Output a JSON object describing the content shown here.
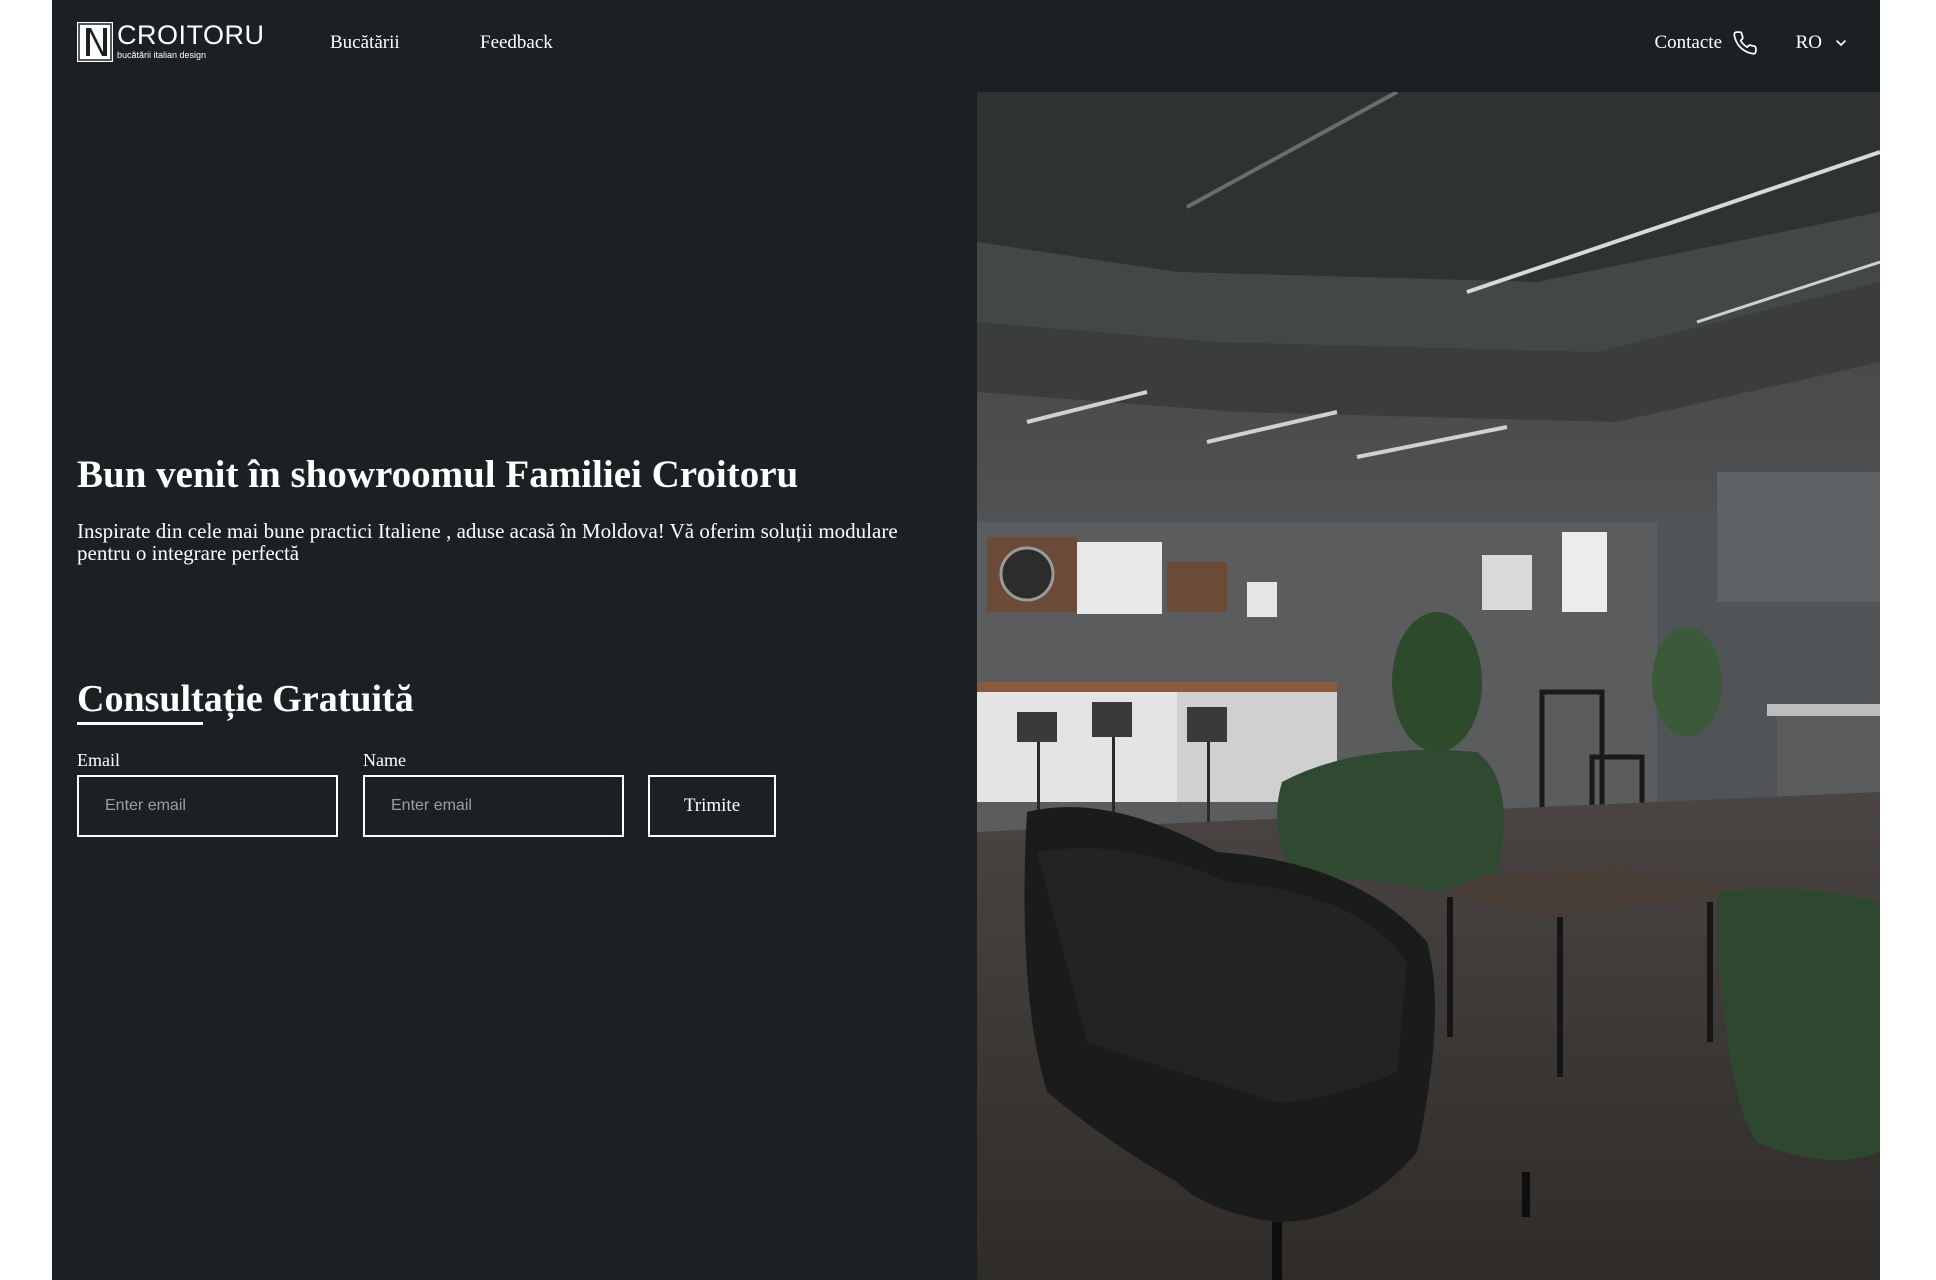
{
  "brand": {
    "name": "CROITORU",
    "tagline": "bucătării italian design",
    "mark_letter": "N"
  },
  "nav": {
    "items": [
      {
        "label": "Bucătării"
      },
      {
        "label": "Feedback"
      }
    ],
    "contact_label": "Contacte",
    "language": "RO"
  },
  "hero": {
    "title": "Bun venit în showroomul Familiei Croitoru",
    "subtitle": "Inspirate din cele mai bune practici Italiene , aduse acasă în Moldova! Vă oferim soluții modulare pentru o integrare perfectă"
  },
  "consultation": {
    "title": "Consultație Gratuită",
    "email_label": "Email",
    "email_placeholder": "Enter email",
    "name_label": "Name",
    "name_placeholder": "Enter email",
    "submit_label": "Trimite"
  },
  "colors": {
    "background": "#1b2022",
    "text": "#ffffff",
    "placeholder": "#9a9fa1"
  },
  "icons": [
    "phone-icon",
    "chevron-down-icon",
    "logo-mark"
  ]
}
